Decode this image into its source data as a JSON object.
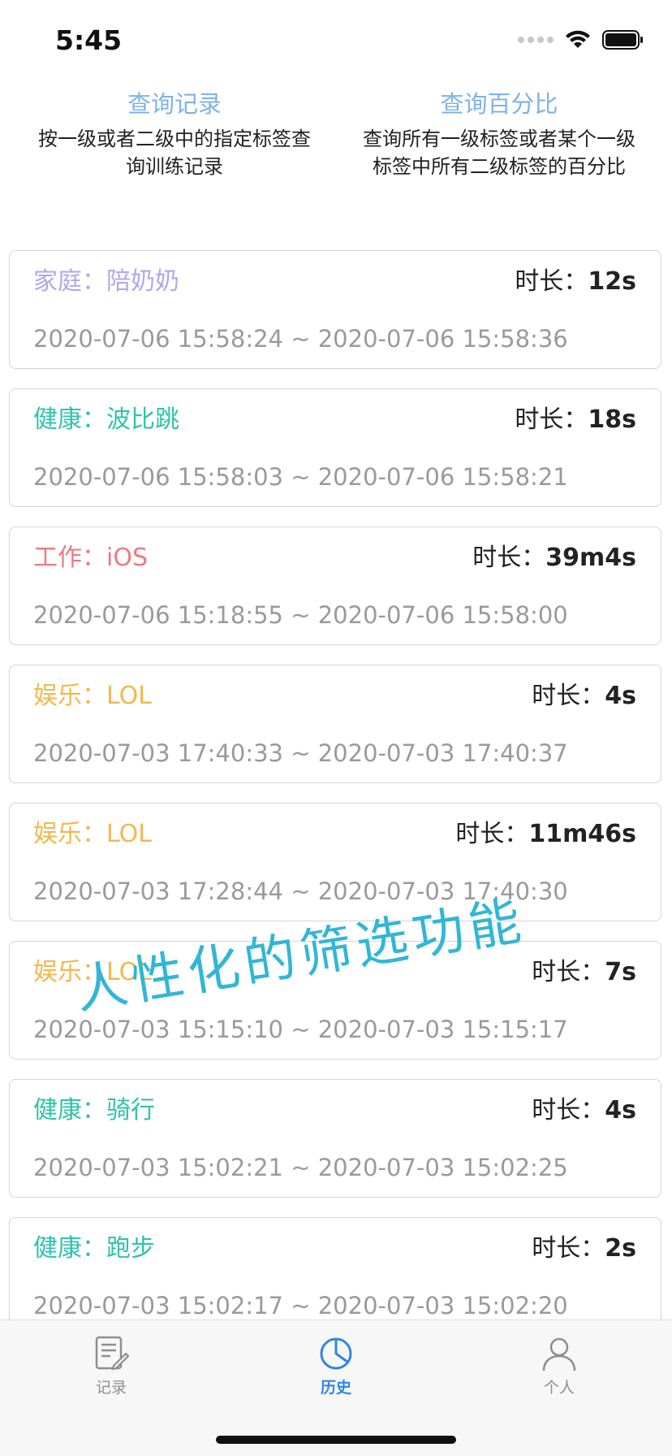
{
  "status_bar": {
    "time": "5:45"
  },
  "query": {
    "left": {
      "title": "查询记录",
      "desc_line1": "按一级或者二级中的指定标签查",
      "desc_line2": "询训练记录"
    },
    "right": {
      "title": "查询百分比",
      "desc_line1": "查询所有一级标签或者某个一级",
      "desc_line2": "标签中所有二级标签的百分比"
    }
  },
  "records": [
    {
      "tag": "家庭：陪奶奶",
      "color": "#b3a6ec",
      "duration_label": "时长：",
      "duration": "12s",
      "range": "2020-07-06 15:58:24 ~ 2020-07-06 15:58:36"
    },
    {
      "tag": "健康：波比跳",
      "color": "#2fc3a9",
      "duration_label": "时长：",
      "duration": "18s",
      "range": "2020-07-06 15:58:03 ~ 2020-07-06 15:58:21"
    },
    {
      "tag": "工作：iOS",
      "color": "#ee7a84",
      "duration_label": "时长：",
      "duration": "39m4s",
      "range": "2020-07-06 15:18:55 ~ 2020-07-06 15:58:00"
    },
    {
      "tag": "娱乐：LOL",
      "color": "#f2b84e",
      "duration_label": "时长：",
      "duration": "4s",
      "range": "2020-07-03 17:40:33 ~ 2020-07-03 17:40:37"
    },
    {
      "tag": "娱乐：LOL",
      "color": "#f2b84e",
      "duration_label": "时长：",
      "duration": "11m46s",
      "range": "2020-07-03 17:28:44 ~ 2020-07-03 17:40:30"
    },
    {
      "tag": "娱乐：LOL",
      "color": "#f2b84e",
      "duration_label": "时长：",
      "duration": "7s",
      "range": "2020-07-03 15:15:10 ~ 2020-07-03 15:15:17"
    },
    {
      "tag": "健康：骑行",
      "color": "#2fc3a9",
      "duration_label": "时长：",
      "duration": "4s",
      "range": "2020-07-03 15:02:21 ~ 2020-07-03 15:02:25"
    },
    {
      "tag": "健康：跑步",
      "color": "#2fc3a9",
      "duration_label": "时长：",
      "duration": "2s",
      "range": "2020-07-03 15:02:17 ~ 2020-07-03 15:02:20"
    }
  ],
  "watermark": "人性化的筛选功能",
  "tabs": [
    {
      "label": "记录",
      "icon": "notepad-icon",
      "active": false
    },
    {
      "label": "历史",
      "icon": "pie-chart-icon",
      "active": true
    },
    {
      "label": "个人",
      "icon": "person-icon",
      "active": false
    }
  ],
  "colors": {
    "accent": "#2f86e6",
    "query_title": "#7fb2e5",
    "watermark": "#28b3d4"
  }
}
